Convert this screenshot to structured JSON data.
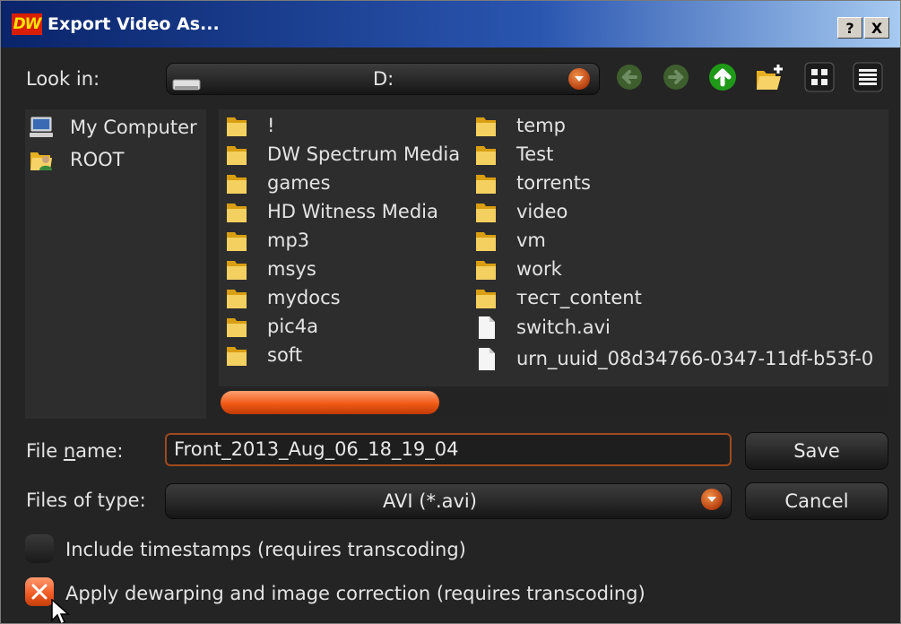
{
  "titlebar": {
    "logo": "DW",
    "title": "Export Video As...",
    "help_label": "?",
    "close_label": "X"
  },
  "look_in": {
    "label": "Look in:",
    "value": "D:"
  },
  "toolbar": {
    "icons": [
      "back-arrow-icon",
      "forward-arrow-icon",
      "up-arrow-icon",
      "new-folder-icon",
      "list-view-icon",
      "detail-view-icon"
    ]
  },
  "sidebar": {
    "items": [
      {
        "label": "My Computer",
        "icon": "computer-icon"
      },
      {
        "label": "ROOT",
        "icon": "folder-user-icon"
      }
    ]
  },
  "files": {
    "column1": [
      {
        "name": "!",
        "type": "folder"
      },
      {
        "name": "DW Spectrum Media",
        "type": "folder"
      },
      {
        "name": "games",
        "type": "folder"
      },
      {
        "name": "HD Witness Media",
        "type": "folder"
      },
      {
        "name": "mp3",
        "type": "folder"
      },
      {
        "name": "msys",
        "type": "folder"
      },
      {
        "name": "mydocs",
        "type": "folder"
      },
      {
        "name": "pic4a",
        "type": "folder"
      },
      {
        "name": "soft",
        "type": "folder"
      }
    ],
    "column2": [
      {
        "name": "temp",
        "type": "folder"
      },
      {
        "name": "Test",
        "type": "folder"
      },
      {
        "name": "torrents",
        "type": "folder"
      },
      {
        "name": "video",
        "type": "folder"
      },
      {
        "name": "vm",
        "type": "folder"
      },
      {
        "name": "work",
        "type": "folder"
      },
      {
        "name": "тест_content",
        "type": "folder"
      },
      {
        "name": "switch.avi",
        "type": "file"
      },
      {
        "name": "urn_uuid_08d34766-0347-11df-b53f-0",
        "type": "file"
      }
    ]
  },
  "file_name": {
    "label_prefix": "File ",
    "label_underlined": "n",
    "label_suffix": "ame:",
    "value": "Front_2013_Aug_06_18_19_04"
  },
  "file_type": {
    "label": "Files of type:",
    "value": "AVI (*.avi)"
  },
  "buttons": {
    "save": "Save",
    "cancel": "Cancel"
  },
  "options": {
    "timestamps": {
      "label": "Include timestamps (requires transcoding)",
      "checked": false
    },
    "dewarping": {
      "label": "Apply dewarping and image correction (requires transcoding)",
      "checked": true
    }
  },
  "colors": {
    "accent": "#f05a16",
    "background": "#242424",
    "panel": "#2d2d2d",
    "titlebar": "#0a246a"
  }
}
